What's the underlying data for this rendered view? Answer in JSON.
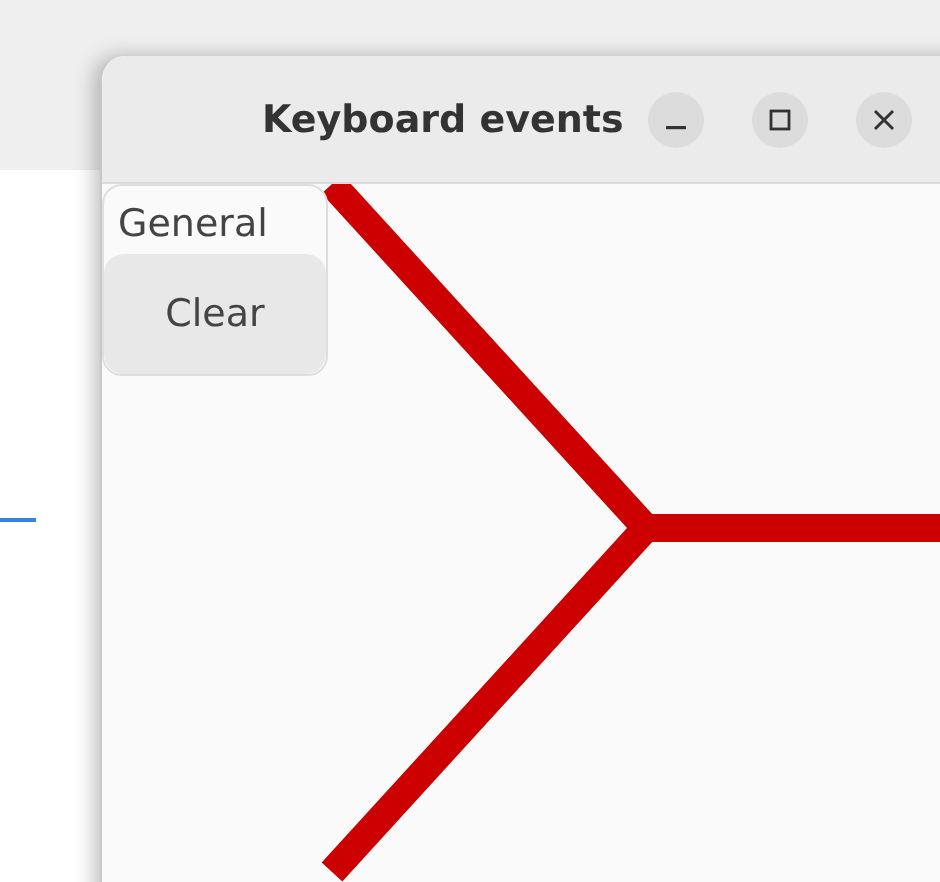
{
  "window": {
    "title": "Keyboard events"
  },
  "menu": {
    "heading": "General",
    "buttons": [
      "Clear"
    ]
  }
}
